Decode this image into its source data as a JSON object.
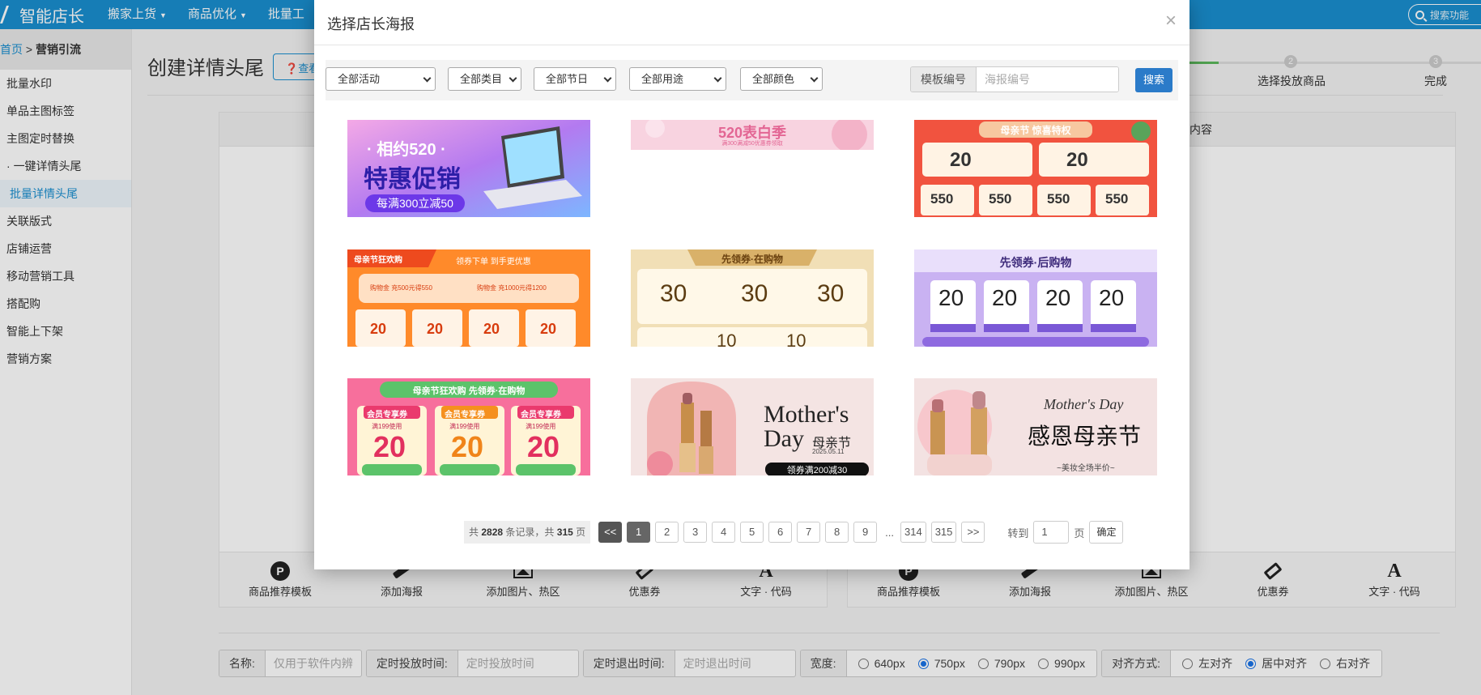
{
  "app": {
    "title": "智能店长",
    "nav": [
      {
        "label": "搬家上货",
        "has_dropdown": true
      },
      {
        "label": "商品优化",
        "has_dropdown": true
      },
      {
        "label": "批量工",
        "has_dropdown": false
      }
    ],
    "search_placeholder": "搜索功能",
    "brand_color": "#1a8fd0"
  },
  "breadcrumb": {
    "home": "首页",
    "separator": ">",
    "current": "营销引流"
  },
  "sidebar": {
    "items": [
      {
        "label": "批量水印"
      },
      {
        "label": "单品主图标签"
      },
      {
        "label": "主图定时替换"
      },
      {
        "label": "一键详情头尾"
      },
      {
        "label": "批量详情头尾",
        "active": true
      },
      {
        "label": "关联版式"
      },
      {
        "label": "店铺运营"
      },
      {
        "label": "移动营销工具"
      },
      {
        "label": "搭配购"
      },
      {
        "label": "智能上下架"
      },
      {
        "label": "营销方案"
      }
    ]
  },
  "main": {
    "page_title": "创建详情头尾",
    "help_label": "查看",
    "steps": [
      {
        "number": "2",
        "label": "选择投放商品"
      },
      {
        "number": "3",
        "label": "完成"
      }
    ],
    "right_panel_header": "内容",
    "tools": [
      {
        "icon": "parking-icon",
        "label": "商品推荐模板"
      },
      {
        "icon": "pen-icon",
        "label": "添加海报"
      },
      {
        "icon": "image-icon",
        "label": "添加图片、热区"
      },
      {
        "icon": "ticket-icon",
        "label": "优惠券"
      },
      {
        "icon": "text-icon",
        "label": "文字 · 代码"
      }
    ],
    "form": {
      "name_label": "名称:",
      "name_placeholder": "仅用于软件内辨",
      "start_label": "定时投放时间:",
      "start_placeholder": "定时投放时间",
      "end_label": "定时退出时间:",
      "end_placeholder": "定时退出时间",
      "width_label": "宽度:",
      "width_options": [
        {
          "label": "640px",
          "selected": false
        },
        {
          "label": "750px",
          "selected": true
        },
        {
          "label": "790px",
          "selected": false
        },
        {
          "label": "990px",
          "selected": false
        }
      ],
      "align_label": "对齐方式:",
      "align_options": [
        {
          "label": "左对齐",
          "selected": false
        },
        {
          "label": "居中对齐",
          "selected": true
        },
        {
          "label": "右对齐",
          "selected": false
        }
      ]
    }
  },
  "modal": {
    "title": "选择店长海报",
    "close_glyph": "×",
    "filters": [
      "全部活动",
      "全部类目",
      "全部节日",
      "全部用途",
      "全部颜色"
    ],
    "code_label": "模板编号",
    "code_placeholder": "海报编号",
    "search_label": "搜索",
    "posters": [
      {
        "kind": "promo-laptop",
        "lines": [
          "· 相约520 ·",
          "特惠促销",
          "每满300立减50"
        ]
      },
      {
        "kind": "confession",
        "lines": [
          "520表白季",
          "满300满减50优惠券领取"
        ]
      },
      {
        "kind": "mothers-coupon-red",
        "lines": [
          "母亲节 惊喜特权",
          "20",
          "20",
          "550",
          "550",
          "550",
          "550"
        ]
      },
      {
        "kind": "orange-coupon",
        "lines": [
          "母亲节狂欢购",
          "领券下单 到手更优惠",
          "购物金 充500元得550",
          "购物金 充1000元得1200",
          "20",
          "20",
          "20",
          "20"
        ]
      },
      {
        "kind": "gold-coupon",
        "lines": [
          "先领券·在购物",
          "30",
          "30",
          "30",
          "10",
          "10"
        ]
      },
      {
        "kind": "purple-coupon",
        "lines": [
          "先领券·后购物",
          "20",
          "20",
          "20",
          "20"
        ]
      },
      {
        "kind": "pink-member",
        "lines": [
          "母亲节狂欢购 先领券·在购物",
          "会员专享券",
          "会员专享券",
          "会员专享券",
          "满199使用",
          "满199使用",
          "满199使用",
          "20",
          "20",
          "20"
        ]
      },
      {
        "kind": "lipstick-mothers",
        "lines": [
          "Mother's",
          "Day",
          "母亲节",
          "2025.05.11",
          "领券满200减30"
        ]
      },
      {
        "kind": "lipstick-thanks",
        "lines": [
          "Mother's Day",
          "感恩母亲节",
          "~美妆全场半价~"
        ]
      }
    ],
    "pager": {
      "info_prefix": "共",
      "total_records": "2828",
      "info_mid": "条记录，共",
      "total_pages": "315",
      "info_suffix": "页",
      "prev": "<<",
      "pages": [
        "1",
        "2",
        "3",
        "4",
        "5",
        "6",
        "7",
        "8",
        "9"
      ],
      "current": "1",
      "ellipsis": "...",
      "last_pages": [
        "314",
        "315"
      ],
      "next": ">>",
      "goto_label": "转到",
      "goto_value": "1",
      "page_unit": "页",
      "confirm": "确定"
    }
  }
}
